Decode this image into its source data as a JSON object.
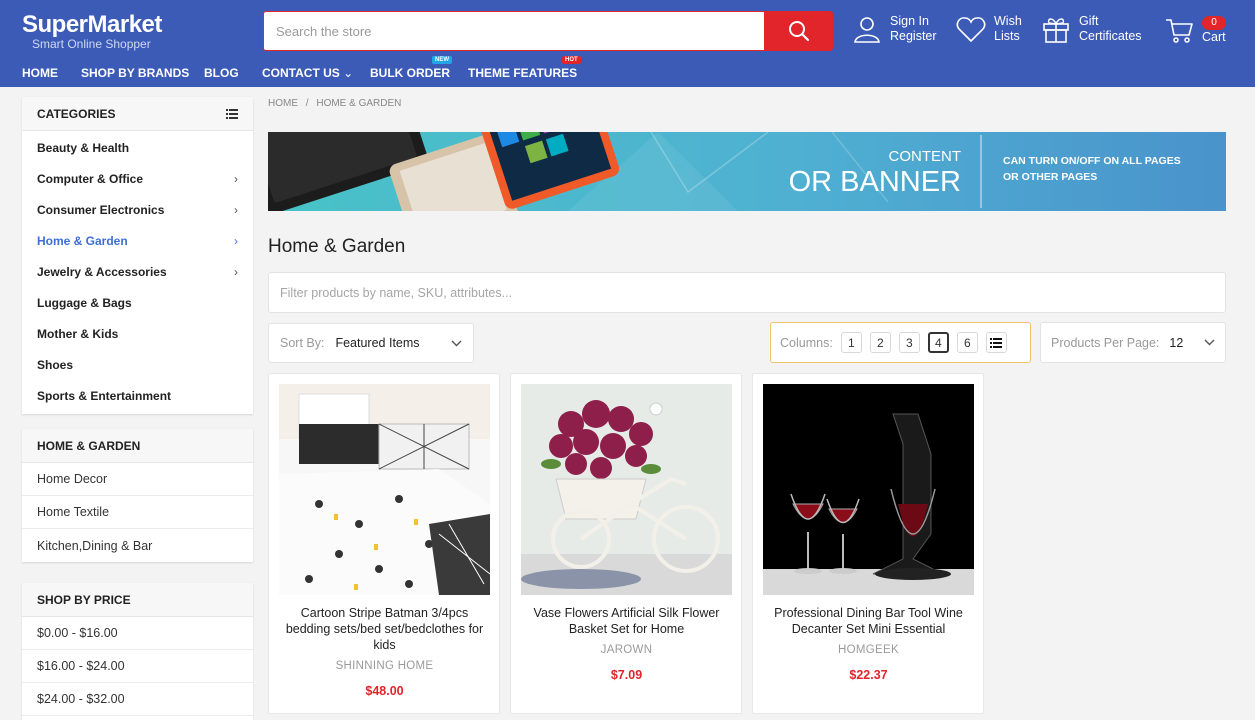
{
  "header": {
    "logo_main": "SuperMarket",
    "logo_sub": "Smart Online Shopper",
    "search_placeholder": "Search the store",
    "account_line1": "Sign In",
    "account_line2": "Register",
    "wish_line1": "Wish",
    "wish_line2": "Lists",
    "gift_line1": "Gift",
    "gift_line2": "Certificates",
    "cart_count": "0",
    "cart_label": "Cart"
  },
  "nav": {
    "items": [
      "HOME",
      "SHOP BY BRANDS",
      "BLOG",
      "CONTACT US",
      "BULK ORDER",
      "THEME FEATURES"
    ],
    "contact_chevron": "⌄",
    "tag_new": "NEW",
    "tag_hot": "HOT"
  },
  "sidebar": {
    "categories_title": "CATEGORIES",
    "categories": [
      {
        "label": "Beauty & Health"
      },
      {
        "label": "Computer & Office"
      },
      {
        "label": "Consumer Electronics"
      },
      {
        "label": "Home & Garden"
      },
      {
        "label": "Jewelry & Accessories"
      },
      {
        "label": "Luggage & Bags"
      },
      {
        "label": "Mother & Kids"
      },
      {
        "label": "Shoes"
      },
      {
        "label": "Sports & Entertainment"
      }
    ],
    "section_title": "HOME & GARDEN",
    "section_items": [
      "Home Decor",
      "Home Textile",
      "Kitchen,Dining & Bar"
    ],
    "price_title": "SHOP BY PRICE",
    "price_items": [
      "$0.00 - $16.00",
      "$16.00 - $24.00",
      "$24.00 - $32.00"
    ]
  },
  "breadcrumb": {
    "home": "HOME",
    "sep": "/",
    "current": "HOME & GARDEN"
  },
  "banner": {
    "line1": "CONTENT",
    "line2": "OR BANNER",
    "note1": "CAN TURN ON/OFF ON ALL PAGES",
    "note2": "OR OTHER PAGES"
  },
  "page_title": "Home & Garden",
  "filter_placeholder": "Filter products by name, SKU, attributes...",
  "sort": {
    "label": "Sort By:",
    "value": "Featured Items"
  },
  "columns": {
    "label": "Columns:",
    "options": [
      "1",
      "2",
      "3",
      "4",
      "6"
    ],
    "selected": "4"
  },
  "per_page": {
    "label": "Products Per Page:",
    "value": "12"
  },
  "products": [
    {
      "title": "Cartoon Stripe Batman 3/4pcs bedding sets/bed set/bedclothes for kids",
      "brand": "SHINNING HOME",
      "price": "$48.00"
    },
    {
      "title": "Vase Flowers Artificial Silk Flower Basket Set for Home",
      "brand": "JAROWN",
      "price": "$7.09"
    },
    {
      "title": "Professional Dining Bar Tool Wine Decanter Set Mini Essential",
      "brand": "HOMGEEK",
      "price": "$22.37"
    }
  ],
  "colors": {
    "header_bg": "#3b5bb7",
    "accent_red": "#e2242b",
    "active_link": "#3b6fd4",
    "banner_bg": "#4fa0cf"
  }
}
